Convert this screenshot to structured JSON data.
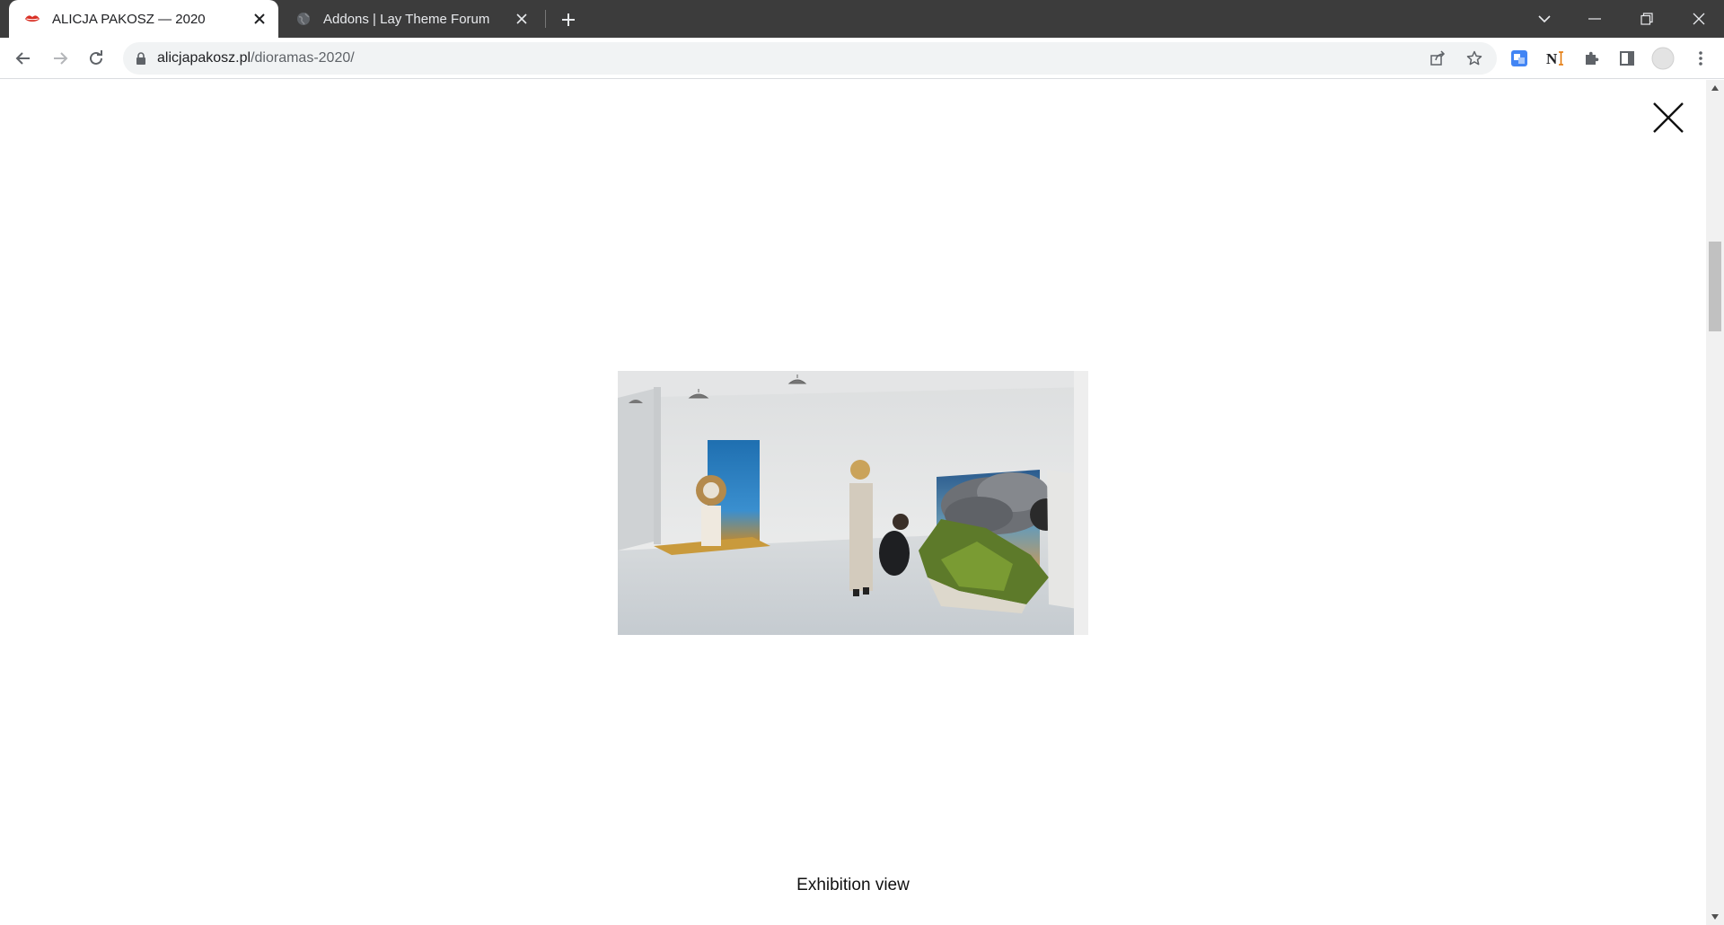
{
  "browser": {
    "tabs": [
      {
        "title": "ALICJA PAKOSZ — 2020",
        "active": true,
        "favicon": "lips-icon"
      },
      {
        "title": "Addons | Lay Theme Forum",
        "active": false,
        "favicon": "globe-icon"
      }
    ],
    "url_host": "alicjapakosz.pl",
    "url_path": "/dioramas-2020/"
  },
  "page": {
    "image_alt": "Exhibition view",
    "caption": "Exhibition view"
  },
  "colors": {
    "tabstrip": "#3c3c3c",
    "omnibox": "#f1f3f4",
    "page_bg": "#ffffff"
  }
}
